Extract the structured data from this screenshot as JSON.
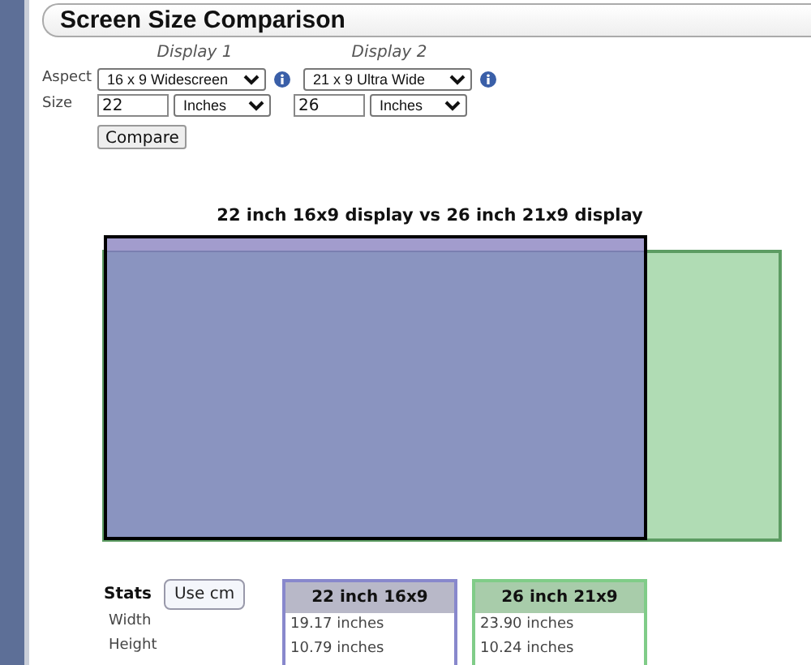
{
  "title": "Screen Size Comparison",
  "display_headers": [
    "Display 1",
    "Display 2"
  ],
  "aspect": {
    "label": "Aspect",
    "selects": [
      {
        "value": "16 x 9 Widescreen"
      },
      {
        "value": "21 x 9 Ultra Wide"
      }
    ]
  },
  "size": {
    "label": "Size",
    "inputs": [
      {
        "value": "22",
        "unit": "Inches"
      },
      {
        "value": "26",
        "unit": "Inches"
      }
    ]
  },
  "compare_button": "Compare",
  "chart_title": "22 inch 16x9 display vs 26 inch 21x9 display",
  "stats": {
    "label": "Stats",
    "unit_button": "Use cm",
    "columns": [
      {
        "header": "22 inch 16x9",
        "color": "#8888cc"
      },
      {
        "header": "26 inch 21x9",
        "color": "#80cc88"
      }
    ],
    "rows": [
      {
        "label": "Width",
        "values": [
          "19.17 inches",
          "23.90 inches"
        ]
      },
      {
        "label": "Height",
        "values": [
          "10.79 inches",
          "10.24 inches"
        ]
      }
    ]
  }
}
